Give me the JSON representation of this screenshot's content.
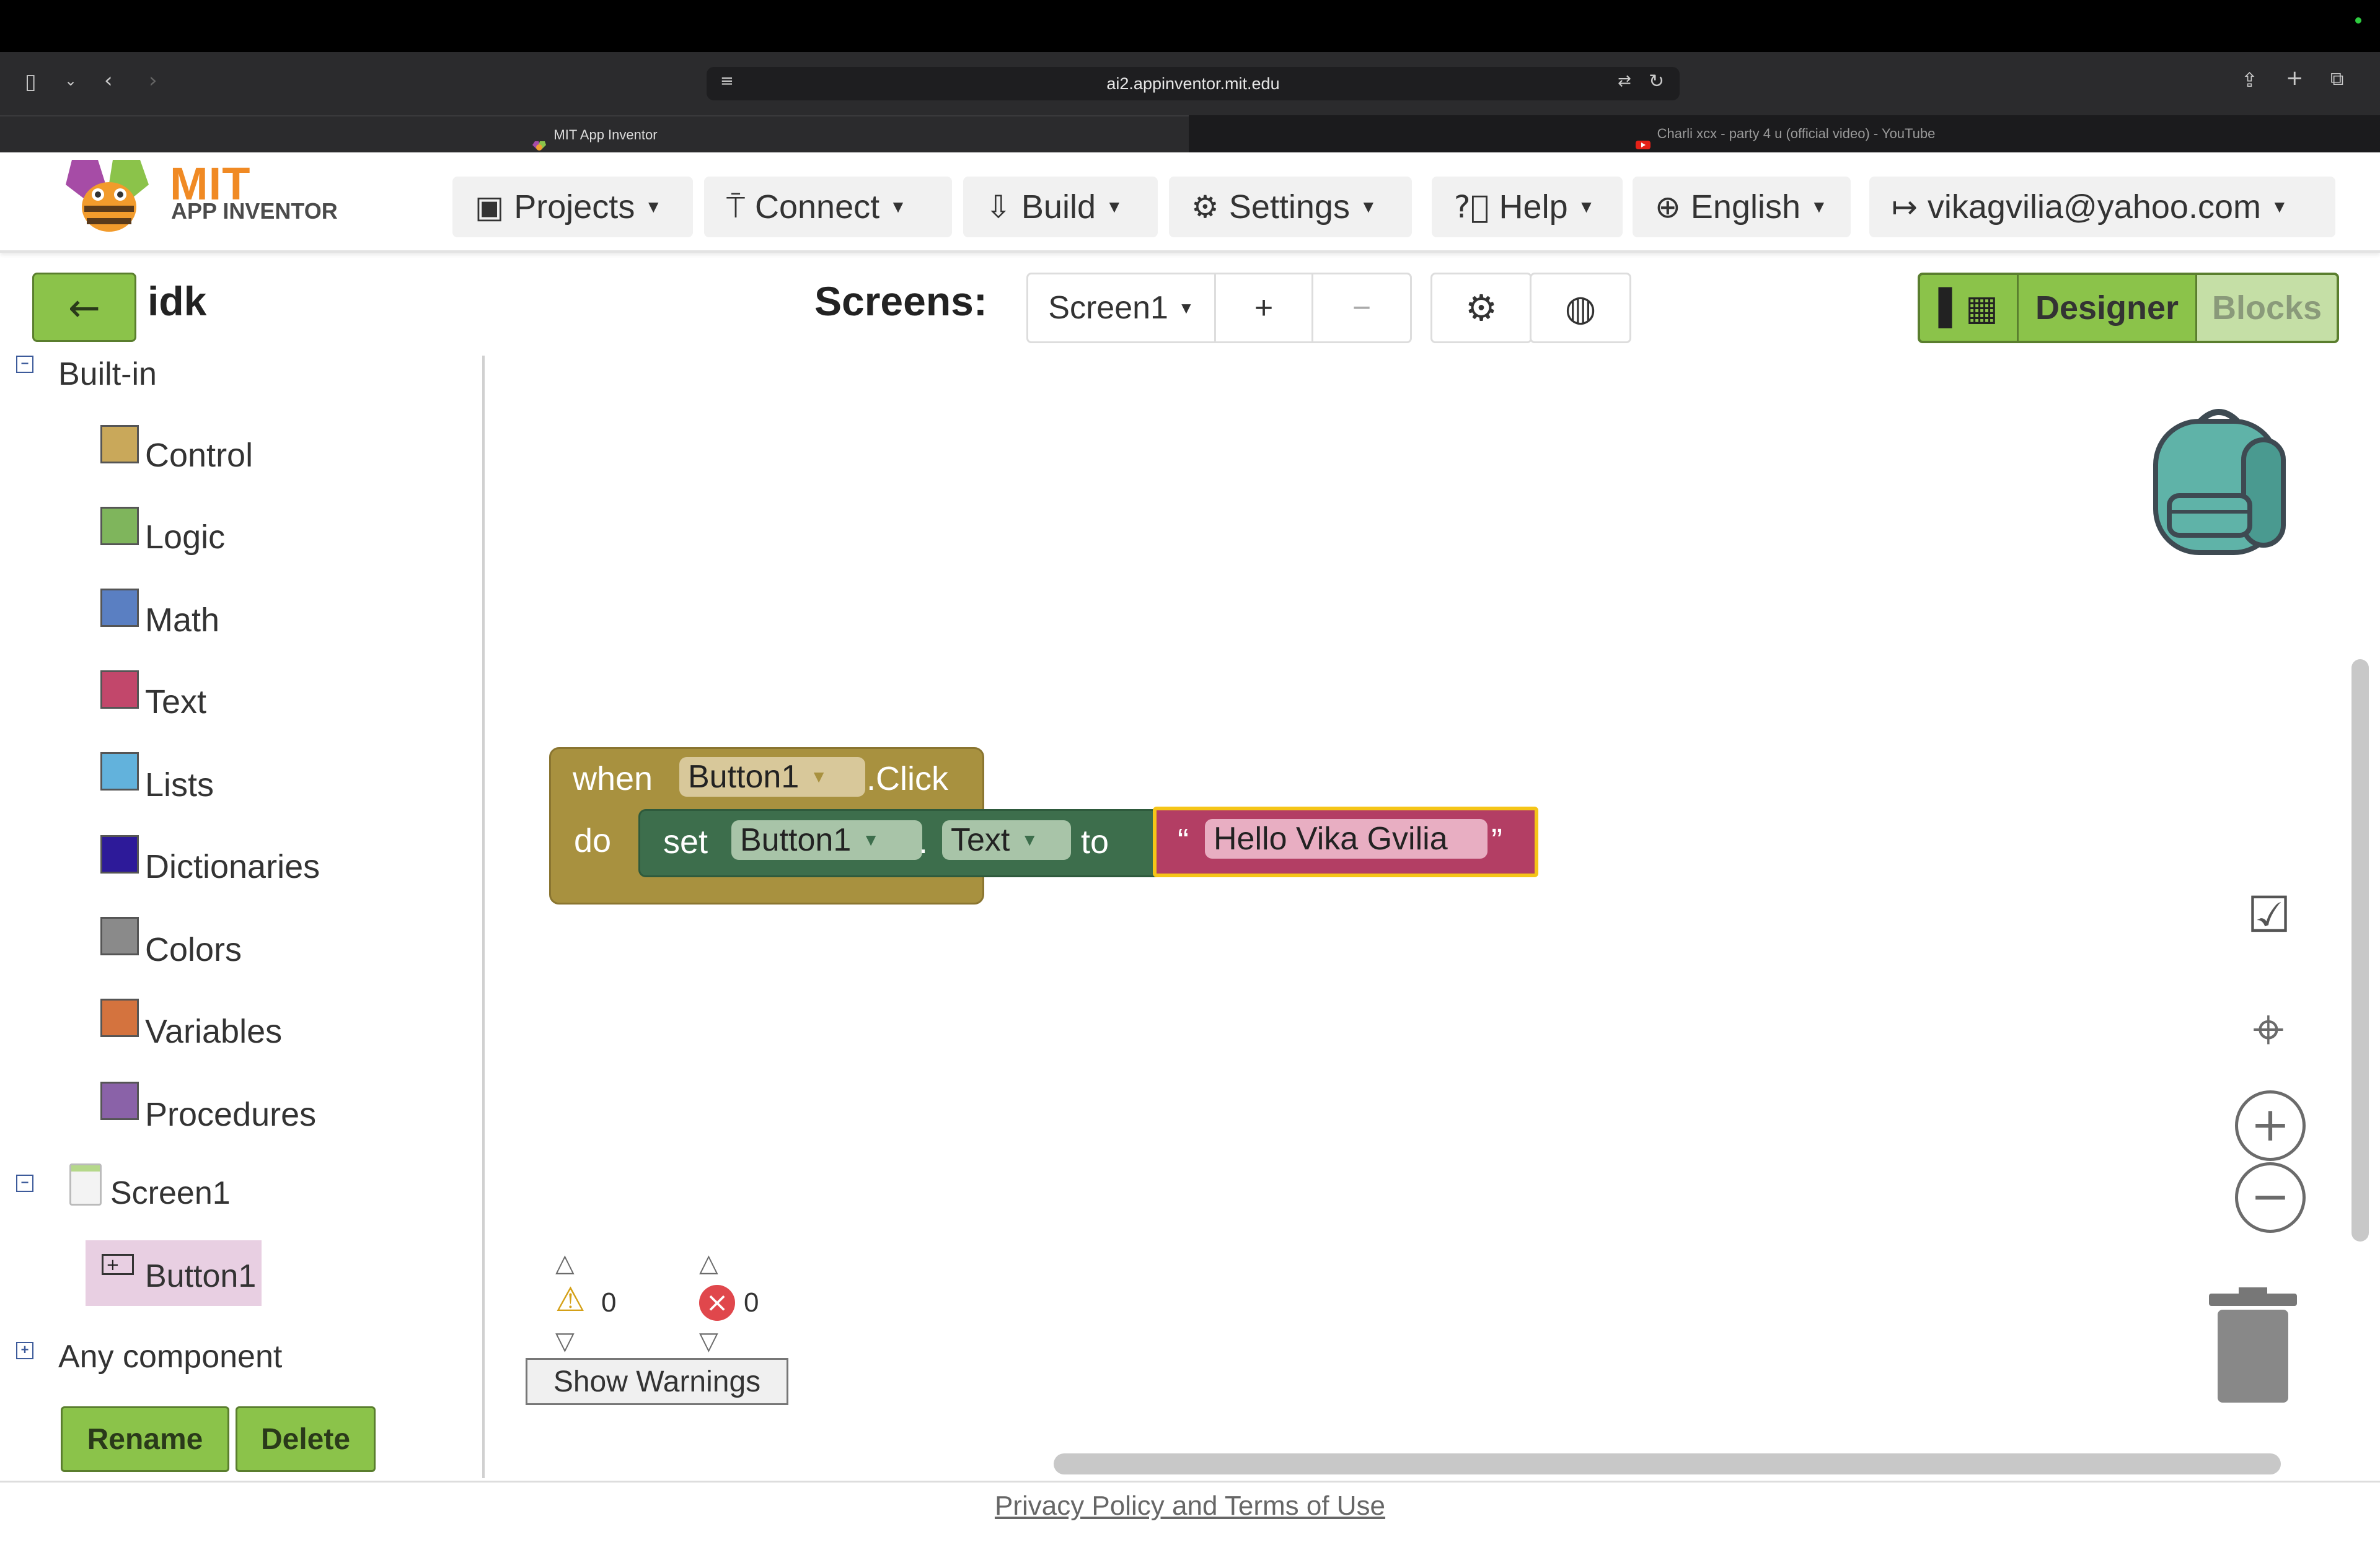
{
  "browser": {
    "url": "ai2.appinventor.mit.edu",
    "tabs": [
      {
        "label": "MIT App Inventor",
        "active": true
      },
      {
        "label": "Charli xcx - party 4 u (official video) - YouTube",
        "active": false
      }
    ]
  },
  "header": {
    "logo_top": "MIT",
    "logo_bottom": "APP INVENTOR",
    "menus": [
      {
        "label": "Projects",
        "icon": "archive-icon"
      },
      {
        "label": "Connect",
        "icon": "antenna-icon"
      },
      {
        "label": "Build",
        "icon": "download-icon"
      },
      {
        "label": "Settings",
        "icon": "gear-icon"
      },
      {
        "label": "Help",
        "icon": "question-icon"
      },
      {
        "label": "English",
        "icon": "globe-icon"
      },
      {
        "label": "vikagvilia@yahoo.com",
        "icon": "logout-icon"
      }
    ]
  },
  "project_bar": {
    "project_name": "idk",
    "screens_label": "Screens:",
    "current_screen": "Screen1",
    "add_screen": "+",
    "remove_screen": "−",
    "designer_label": "Designer",
    "blocks_label": "Blocks"
  },
  "sidebar": {
    "builtin_label": "Built-in",
    "categories": [
      {
        "label": "Control",
        "color": "#c9a85a"
      },
      {
        "label": "Logic",
        "color": "#7fb55c"
      },
      {
        "label": "Math",
        "color": "#5a7fc2"
      },
      {
        "label": "Text",
        "color": "#c2476b"
      },
      {
        "label": "Lists",
        "color": "#62b2dc"
      },
      {
        "label": "Dictionaries",
        "color": "#2d1a99"
      },
      {
        "label": "Colors",
        "color": "#8a8a8a"
      },
      {
        "label": "Variables",
        "color": "#d4733e"
      },
      {
        "label": "Procedures",
        "color": "#8a62a8"
      }
    ],
    "screen_node": "Screen1",
    "component_node": "Button1",
    "any_component": "Any component",
    "rename_label": "Rename",
    "delete_label": "Delete"
  },
  "blocks": {
    "event": {
      "when": "when",
      "component": "Button1",
      "event": ".Click",
      "do": "do",
      "color": "#a8913f"
    },
    "setter": {
      "set": "set",
      "component": "Button1",
      "dot": ".",
      "property": "Text",
      "to": "to",
      "color": "#3d6e4c"
    },
    "text_value": {
      "open_quote": "“",
      "value": "Hello Vika Gvilia",
      "close_quote": "”",
      "color": "#b33e64"
    }
  },
  "workspace": {
    "warnings_count": "0",
    "errors_count": "0",
    "show_warnings_label": "Show Warnings"
  },
  "footer": {
    "privacy_label": "Privacy Policy and Terms of Use"
  }
}
